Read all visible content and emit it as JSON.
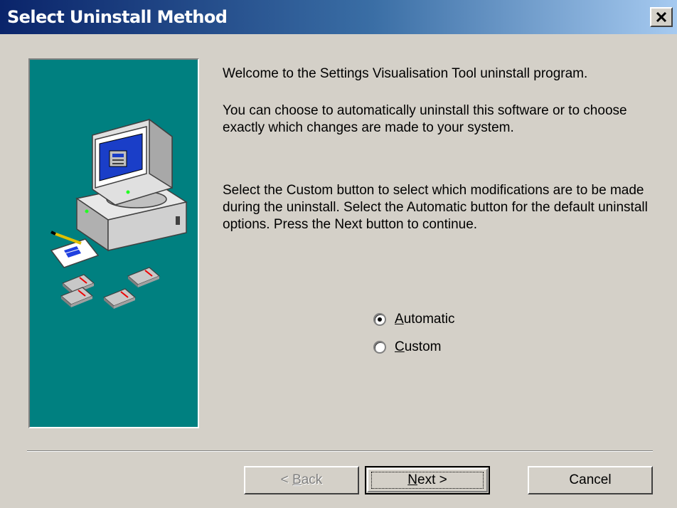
{
  "window": {
    "title": "Select Uninstall Method"
  },
  "main": {
    "welcome": "Welcome to the Settings Visualisation Tool uninstall program.",
    "choose": "You can choose to automatically uninstall this software or to choose exactly which changes are made to your system.",
    "instructions": "Select the Custom button to select which modifications are to be made during the uninstall. Select the Automatic button for the default uninstall options. Press the Next button to continue."
  },
  "options": [
    {
      "label": "Automatic",
      "accel": "A",
      "rest": "utomatic",
      "selected": true
    },
    {
      "label": "Custom",
      "accel": "C",
      "rest": "ustom",
      "selected": false
    }
  ],
  "buttons": {
    "back_prefix": "< ",
    "back_accel": "B",
    "back_rest": "ack",
    "next_accel": "N",
    "next_rest": "ext >",
    "cancel": "Cancel"
  },
  "colors": {
    "panel": "#008080",
    "title_start": "#0a246a",
    "title_end": "#a6caf0"
  },
  "icons": [
    "close-icon",
    "computer-icon",
    "document-icon",
    "floppy-disk-icon"
  ]
}
